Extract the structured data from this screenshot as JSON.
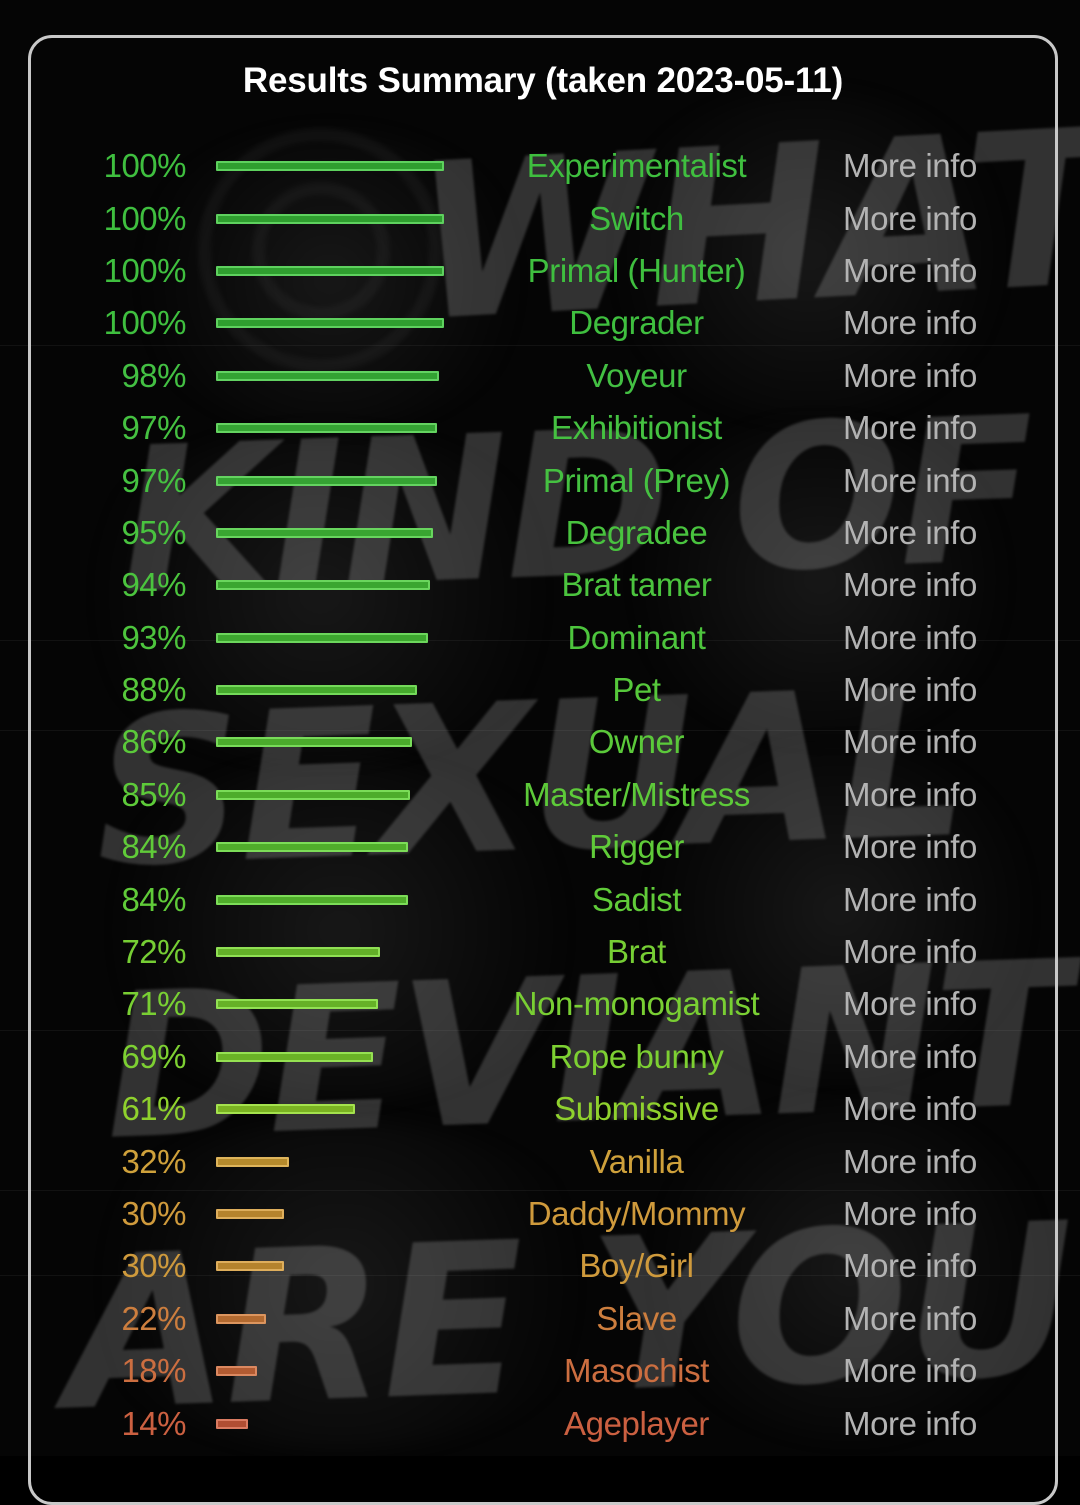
{
  "card": {
    "title": "Results Summary (taken 2023-05-11)",
    "border_color": "#c9c9c9",
    "background_color": "#050505"
  },
  "background": {
    "watermark_text": "WHAT KIND OF SEXUAL DEVIANT ARE YOU",
    "watermark_lines": [
      "WHAT",
      "KIND OF",
      "SEXUAL",
      "DEVIANT",
      "ARE YOU"
    ]
  },
  "more_info_label": "More info",
  "chart_data": {
    "type": "bar",
    "title": "Results Summary (taken 2023-05-11)",
    "xlabel": "",
    "ylabel": "",
    "xlim": [
      0,
      100
    ],
    "grid": false,
    "legend": "none",
    "orientation": "horizontal",
    "unit": "%",
    "categories": [
      "Experimentalist",
      "Switch",
      "Primal (Hunter)",
      "Degrader",
      "Voyeur",
      "Exhibitionist",
      "Primal (Prey)",
      "Degradee",
      "Brat tamer",
      "Dominant",
      "Pet",
      "Owner",
      "Master/Mistress",
      "Rigger",
      "Sadist",
      "Brat",
      "Non-monogamist",
      "Rope bunny",
      "Submissive",
      "Vanilla",
      "Daddy/Mommy",
      "Boy/Girl",
      "Slave",
      "Masochist",
      "Ageplayer"
    ],
    "values": [
      100,
      100,
      100,
      100,
      98,
      97,
      97,
      95,
      94,
      93,
      88,
      86,
      85,
      84,
      84,
      72,
      71,
      69,
      61,
      32,
      30,
      30,
      22,
      18,
      14
    ]
  },
  "rows": [
    {
      "percent": "100%",
      "value": 100,
      "label": "Experimentalist",
      "more": "More info",
      "text_color": "#3fbf3f",
      "bar_fill": "#2f9e2f",
      "bar_edge": "#5ed15e"
    },
    {
      "percent": "100%",
      "value": 100,
      "label": "Switch",
      "more": "More info",
      "text_color": "#3fbf3f",
      "bar_fill": "#2f9e2f",
      "bar_edge": "#5ed15e"
    },
    {
      "percent": "100%",
      "value": 100,
      "label": "Primal (Hunter)",
      "more": "More info",
      "text_color": "#3fbf3f",
      "bar_fill": "#2f9e2f",
      "bar_edge": "#5ed15e"
    },
    {
      "percent": "100%",
      "value": 100,
      "label": "Degrader",
      "more": "More info",
      "text_color": "#3fbf3f",
      "bar_fill": "#2f9e2f",
      "bar_edge": "#5ed15e"
    },
    {
      "percent": "98%",
      "value": 98,
      "label": "Voyeur",
      "more": "More info",
      "text_color": "#43c043",
      "bar_fill": "#33a233",
      "bar_edge": "#62d262"
    },
    {
      "percent": "97%",
      "value": 97,
      "label": "Exhibitionist",
      "more": "More info",
      "text_color": "#45c141",
      "bar_fill": "#35a333",
      "bar_edge": "#64d360"
    },
    {
      "percent": "97%",
      "value": 97,
      "label": "Primal (Prey)",
      "more": "More info",
      "text_color": "#45c141",
      "bar_fill": "#35a333",
      "bar_edge": "#64d360"
    },
    {
      "percent": "95%",
      "value": 95,
      "label": "Degradee",
      "more": "More info",
      "text_color": "#49c33f",
      "bar_fill": "#39a531",
      "bar_edge": "#68d55e"
    },
    {
      "percent": "94%",
      "value": 94,
      "label": "Brat tamer",
      "more": "More info",
      "text_color": "#4bc43e",
      "bar_fill": "#3ba630",
      "bar_edge": "#6ad65d"
    },
    {
      "percent": "93%",
      "value": 93,
      "label": "Dominant",
      "more": "More info",
      "text_color": "#4dc53d",
      "bar_fill": "#3da72f",
      "bar_edge": "#6cd75c"
    },
    {
      "percent": "88%",
      "value": 88,
      "label": "Pet",
      "more": "More info",
      "text_color": "#56c83b",
      "bar_fill": "#46aa2d",
      "bar_edge": "#74da5a"
    },
    {
      "percent": "86%",
      "value": 86,
      "label": "Owner",
      "more": "More info",
      "text_color": "#5bc93a",
      "bar_fill": "#4bab2c",
      "bar_edge": "#78db59"
    },
    {
      "percent": "85%",
      "value": 85,
      "label": "Master/Mistress",
      "more": "More info",
      "text_color": "#5dca39",
      "bar_fill": "#4dac2b",
      "bar_edge": "#7adc58"
    },
    {
      "percent": "84%",
      "value": 84,
      "label": "Rigger",
      "more": "More info",
      "text_color": "#60cb39",
      "bar_fill": "#50ad2b",
      "bar_edge": "#7cdd58"
    },
    {
      "percent": "84%",
      "value": 84,
      "label": "Sadist",
      "more": "More info",
      "text_color": "#60cb39",
      "bar_fill": "#50ad2b",
      "bar_edge": "#7cdd58"
    },
    {
      "percent": "72%",
      "value": 72,
      "label": "Brat",
      "more": "More info",
      "text_color": "#76ce34",
      "bar_fill": "#63b028",
      "bar_edge": "#90e054"
    },
    {
      "percent": "71%",
      "value": 71,
      "label": "Non-monogamist",
      "more": "More info",
      "text_color": "#79cf33",
      "bar_fill": "#66b127",
      "bar_edge": "#92e153"
    },
    {
      "percent": "69%",
      "value": 69,
      "label": "Rope bunny",
      "more": "More info",
      "text_color": "#7dd032",
      "bar_fill": "#6ab226",
      "bar_edge": "#95e152"
    },
    {
      "percent": "61%",
      "value": 61,
      "label": "Submissive",
      "more": "More info",
      "text_color": "#8fd12d",
      "bar_fill": "#7bb322",
      "bar_edge": "#a4e24d"
    },
    {
      "percent": "32%",
      "value": 32,
      "label": "Vanilla",
      "more": "More info",
      "text_color": "#cfa13b",
      "bar_fill": "#b58a2c",
      "bar_edge": "#deb45b"
    },
    {
      "percent": "30%",
      "value": 30,
      "label": "Daddy/Mommy",
      "more": "More info",
      "text_color": "#cf9a3c",
      "bar_fill": "#b5832d",
      "bar_edge": "#deae5c"
    },
    {
      "percent": "30%",
      "value": 30,
      "label": "Boy/Girl",
      "more": "More info",
      "text_color": "#cf9a3c",
      "bar_fill": "#b5832d",
      "bar_edge": "#deae5c"
    },
    {
      "percent": "22%",
      "value": 22,
      "label": "Slave",
      "more": "More info",
      "text_color": "#cd7e3e",
      "bar_fill": "#b36a30",
      "bar_edge": "#dc955e"
    },
    {
      "percent": "18%",
      "value": 18,
      "label": "Masochist",
      "more": "More info",
      "text_color": "#cc6e40",
      "bar_fill": "#b25b32",
      "bar_edge": "#db8860"
    },
    {
      "percent": "14%",
      "value": 14,
      "label": "Ageplayer",
      "more": "More info",
      "text_color": "#cb6041",
      "bar_fill": "#b14e33",
      "bar_edge": "#da7b61"
    }
  ]
}
